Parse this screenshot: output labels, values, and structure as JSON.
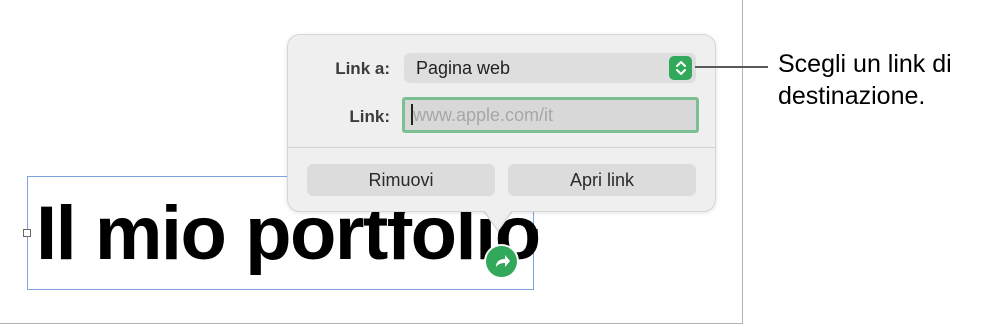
{
  "document": {
    "headline": "Il mio portfolio"
  },
  "link_popover": {
    "link_to_label": "Link a:",
    "link_to_value": "Pagina web",
    "link_label": "Link:",
    "link_value": "",
    "link_placeholder": "www.apple.com/it",
    "remove_button": "Rimuovi",
    "open_link_button": "Apri link"
  },
  "callout": {
    "text": "Scegli un link di destinazione."
  },
  "colors": {
    "accent_green": "#31a85a",
    "focus_ring": "#7cbf92",
    "selection_border": "#7fa3e0"
  },
  "icons": {
    "stepper": "up-down-chevron-icon",
    "link_badge": "curved-arrow-icon"
  }
}
